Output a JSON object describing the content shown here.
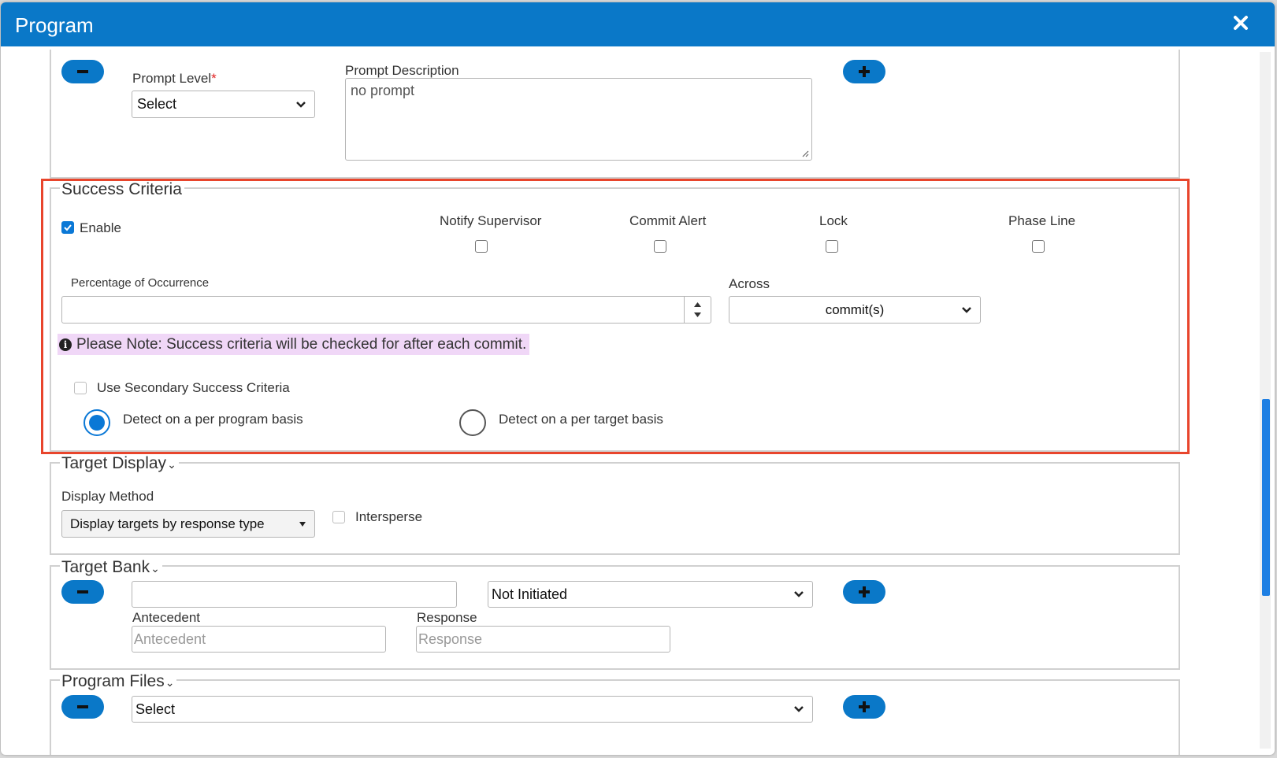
{
  "window": {
    "title": "Program",
    "close_icon": "close-icon"
  },
  "prompt": {
    "level_label": "Prompt Level",
    "level_required": "*",
    "level_value": "Select",
    "description_label": "Prompt Description",
    "description_value": "no prompt"
  },
  "success_criteria": {
    "legend": "Success Criteria",
    "enable_label": "Enable",
    "enable_checked": true,
    "notify_supervisor_label": "Notify Supervisor",
    "commit_alert_label": "Commit Alert",
    "lock_label": "Lock",
    "phase_line_label": "Phase Line",
    "percentage_label": "Percentage of Occurrence",
    "percentage_value": "",
    "across_label": "Across",
    "across_value": "commit(s)",
    "note_text": "Please Note: Success criteria will be checked for after each commit.",
    "secondary_label": "Use Secondary Success Criteria",
    "detect_program_label": "Detect on a per program basis",
    "detect_target_label": "Detect on a per target basis",
    "selected_detect": "program"
  },
  "target_display": {
    "legend": "Target Display",
    "display_method_label": "Display Method",
    "display_method_value": "Display targets by response type",
    "intersperse_label": "Intersperse"
  },
  "target_bank": {
    "legend": "Target Bank",
    "target_value": "",
    "status_value": "Not Initiated",
    "antecedent_label": "Antecedent",
    "antecedent_placeholder": "Antecedent",
    "response_label": "Response",
    "response_placeholder": "Response"
  },
  "program_files": {
    "legend": "Program Files",
    "select_value": "Select"
  },
  "colors": {
    "header": "#0a78c8",
    "accent": "#0a78d6",
    "highlight_border": "#e8452c",
    "note_background": "#f0d7f7"
  }
}
